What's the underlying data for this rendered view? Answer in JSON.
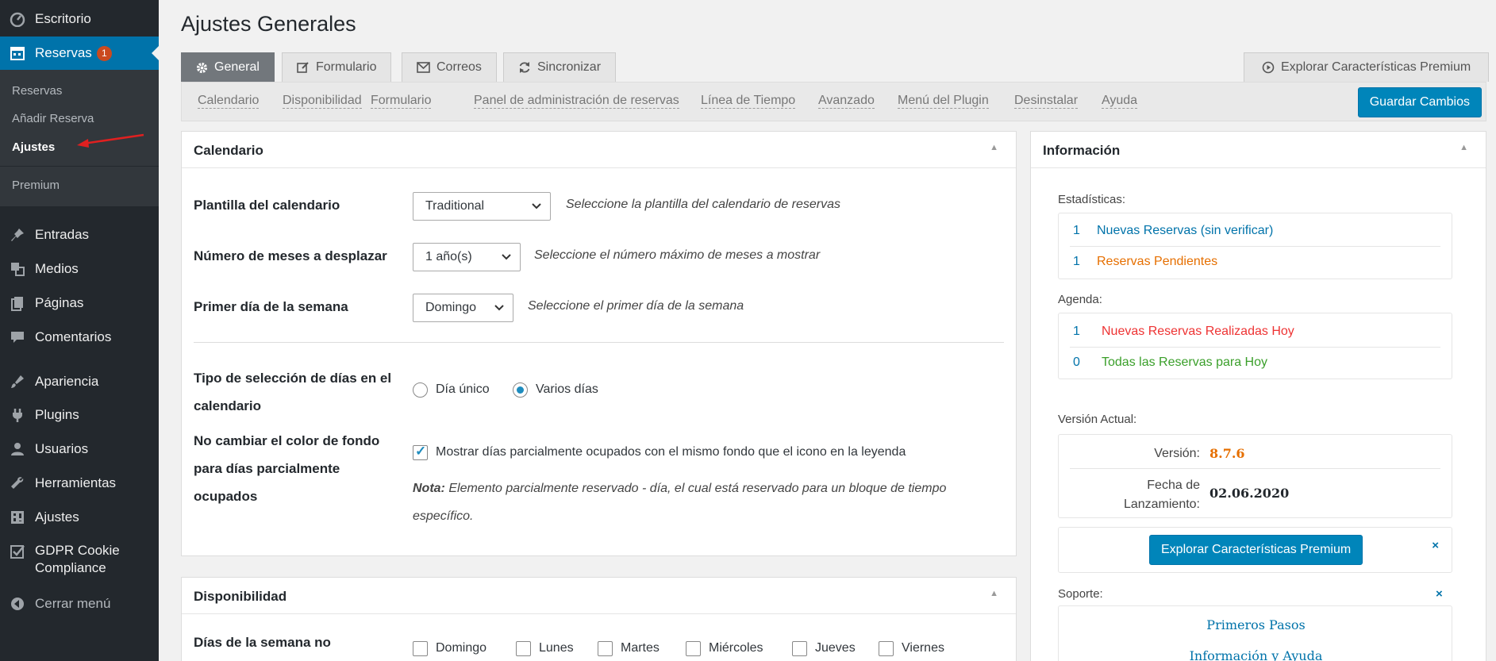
{
  "sidebar": {
    "items": [
      {
        "label": "Escritorio",
        "icon": "dashboard-icon"
      },
      {
        "label": "Reservas",
        "icon": "calendar-icon",
        "badge": "1"
      },
      {
        "label": "Entradas",
        "icon": "pin-icon"
      },
      {
        "label": "Medios",
        "icon": "media-icon"
      },
      {
        "label": "Páginas",
        "icon": "pages-icon"
      },
      {
        "label": "Comentarios",
        "icon": "comment-icon"
      },
      {
        "label": "Apariencia",
        "icon": "brush-icon"
      },
      {
        "label": "Plugins",
        "icon": "plug-icon"
      },
      {
        "label": "Usuarios",
        "icon": "user-icon"
      },
      {
        "label": "Herramientas",
        "icon": "wrench-icon"
      },
      {
        "label": "Ajustes",
        "icon": "settings-icon"
      },
      {
        "label": "GDPR Cookie",
        "label2": "Compliance",
        "icon": "check-shield-icon"
      },
      {
        "label": "Cerrar menú",
        "icon": "collapse-icon"
      }
    ],
    "submenu": [
      "Reservas",
      "Añadir Reserva",
      "Ajustes",
      "Premium"
    ]
  },
  "page": {
    "title": "Ajustes Generales"
  },
  "tabs": [
    "General",
    "Formulario",
    "Correos",
    "Sincronizar"
  ],
  "premium_tab": "Explorar Características Premium",
  "subnav": [
    "Calendario",
    "Disponibilidad",
    "Formulario",
    "Panel de administración de reservas",
    "Línea de Tiempo",
    "Avanzado",
    "Menú del Plugin",
    "Desinstalar",
    "Ayuda"
  ],
  "save_label": "Guardar Cambios",
  "calendar_panel": {
    "title": "Calendario",
    "template_label": "Plantilla del calendario",
    "template_value": "Traditional",
    "template_hint": "Seleccione la plantilla del calendario de reservas",
    "months_label": "Número de meses a desplazar",
    "months_value": "1 año(s)",
    "months_hint": "Seleccione el número máximo de meses a mostrar",
    "firstday_label": "Primer día de la semana",
    "firstday_value": "Domingo",
    "firstday_hint": "Seleccione el primer día de la semana",
    "selection_label_1": "Tipo de selección de días en el",
    "selection_label_2": "calendario",
    "opt_single": "Día único",
    "opt_multiple": "Varios días",
    "bg_label_1": "No cambiar el color de fondo",
    "bg_label_2": "para días parcialmente",
    "bg_label_3": "ocupados",
    "bg_checkbox": "Mostrar días parcialmente ocupados con el mismo fondo que el icono en la leyenda",
    "note_bold": "Nota:",
    "note_text_1": "Elemento parcialmente reservado - día, el cual está reservado para un bloque de tiempo",
    "note_text_2": "específico."
  },
  "availability_panel": {
    "title": "Disponibilidad",
    "days_label": "Días de la semana no",
    "days": [
      "Domingo",
      "Lunes",
      "Martes",
      "Miércoles",
      "Jueves",
      "Viernes"
    ]
  },
  "info_panel": {
    "title": "Información",
    "stats_label": "Estadísticas:",
    "stats": [
      {
        "num": "1",
        "text": "Nuevas Reservas (sin verificar)",
        "color": "#0073aa"
      },
      {
        "num": "1",
        "text": "Reservas Pendientes",
        "color": "#e66f00"
      }
    ],
    "agenda_label": "Agenda:",
    "agenda": [
      {
        "num": "1",
        "text": "Nuevas Reservas Realizadas Hoy",
        "color": "#e33"
      },
      {
        "num": "0",
        "text": "Todas las Reservas para Hoy",
        "color": "#3a9f2a"
      }
    ],
    "version_label": "Versión Actual:",
    "version_key": "Versión:",
    "version_value": "8.7.6",
    "release_key_1": "Fecha de",
    "release_key_2": "Lanzamiento:",
    "release_value": "02.06.2020",
    "premium_button": "Explorar Características Premium",
    "close": "×",
    "support_label": "Soporte:",
    "support_links": [
      "Primeros Pasos",
      "Información y Ayuda"
    ]
  }
}
